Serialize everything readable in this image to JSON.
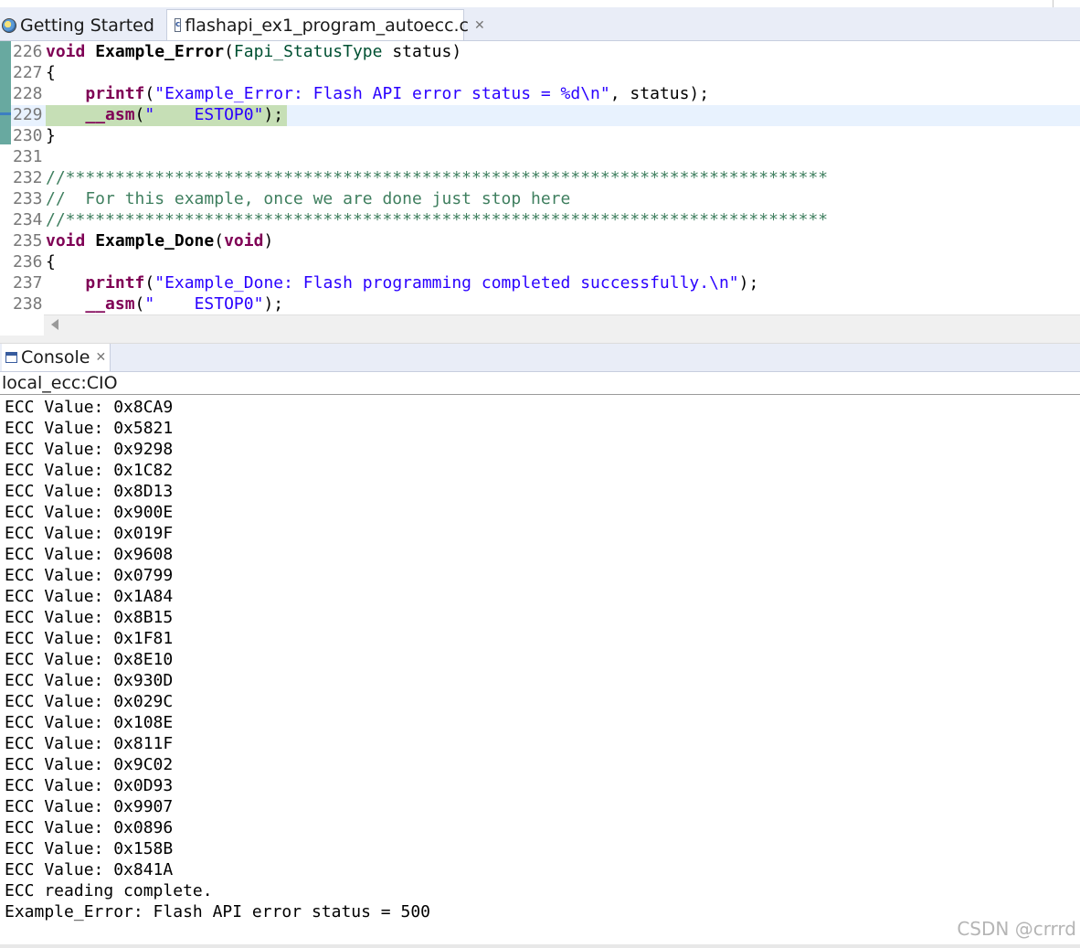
{
  "tabs": [
    {
      "label": "Getting Started",
      "icon": "ccs-globe-icon"
    },
    {
      "label": "flashapi_ex1_program_autoecc.c",
      "icon": "c-file-icon",
      "active": true
    }
  ],
  "editor": {
    "lines": [
      {
        "num": "226",
        "tokens": [
          {
            "t": "void ",
            "c": "kw"
          },
          {
            "t": "Example_Error",
            "c": "fn"
          },
          {
            "t": "(",
            "c": ""
          },
          {
            "t": "Fapi_StatusType",
            "c": "ty"
          },
          {
            "t": " status)",
            "c": ""
          }
        ]
      },
      {
        "num": "227",
        "tokens": [
          {
            "t": "{",
            "c": ""
          }
        ]
      },
      {
        "num": "228",
        "tokens": [
          {
            "t": "    ",
            "c": ""
          },
          {
            "t": "printf",
            "c": "kw"
          },
          {
            "t": "(",
            "c": ""
          },
          {
            "t": "\"Example_Error: Flash API error status = %d\\n\"",
            "c": "str"
          },
          {
            "t": ", status);",
            "c": ""
          }
        ]
      },
      {
        "num": "229",
        "tokens": [
          {
            "t": "    ",
            "c": ""
          },
          {
            "t": "__asm",
            "c": "kw"
          },
          {
            "t": "(",
            "c": ""
          },
          {
            "t": "\"    ESTOP0\"",
            "c": "str"
          },
          {
            "t": ");",
            "c": ""
          }
        ]
      },
      {
        "num": "230",
        "tokens": [
          {
            "t": "}",
            "c": ""
          }
        ]
      },
      {
        "num": "231",
        "tokens": []
      },
      {
        "num": "232",
        "tokens": [
          {
            "t": "//*****************************************************************************",
            "c": "cm"
          }
        ]
      },
      {
        "num": "233",
        "tokens": [
          {
            "t": "//  For this example, once we are done just stop here",
            "c": "cm"
          }
        ]
      },
      {
        "num": "234",
        "tokens": [
          {
            "t": "//*****************************************************************************",
            "c": "cm"
          }
        ]
      },
      {
        "num": "235",
        "tokens": [
          {
            "t": "void ",
            "c": "kw"
          },
          {
            "t": "Example_Done",
            "c": "fn"
          },
          {
            "t": "(",
            "c": ""
          },
          {
            "t": "void",
            "c": "kw"
          },
          {
            "t": ")",
            "c": ""
          }
        ]
      },
      {
        "num": "236",
        "tokens": [
          {
            "t": "{",
            "c": ""
          }
        ]
      },
      {
        "num": "237",
        "tokens": [
          {
            "t": "    ",
            "c": ""
          },
          {
            "t": "printf",
            "c": "kw"
          },
          {
            "t": "(",
            "c": ""
          },
          {
            "t": "\"Example_Done: Flash programming completed successfully.\\n\"",
            "c": "str"
          },
          {
            "t": ");",
            "c": ""
          }
        ]
      },
      {
        "num": "238",
        "tokens": [
          {
            "t": "    ",
            "c": ""
          },
          {
            "t": "__asm",
            "c": "kw"
          },
          {
            "t": "(",
            "c": ""
          },
          {
            "t": "\"    ESTOP0\"",
            "c": "str"
          },
          {
            "t": ");",
            "c": ""
          }
        ]
      }
    ]
  },
  "console": {
    "tab_label": "Console",
    "title": "local_ecc:CIO",
    "lines": [
      "ECC Value: 0x8CA9",
      "ECC Value: 0x5821",
      "ECC Value: 0x9298",
      "ECC Value: 0x1C82",
      "ECC Value: 0x8D13",
      "ECC Value: 0x900E",
      "ECC Value: 0x019F",
      "ECC Value: 0x9608",
      "ECC Value: 0x0799",
      "ECC Value: 0x1A84",
      "ECC Value: 0x8B15",
      "ECC Value: 0x1F81",
      "ECC Value: 0x8E10",
      "ECC Value: 0x930D",
      "ECC Value: 0x029C",
      "ECC Value: 0x108E",
      "ECC Value: 0x811F",
      "ECC Value: 0x9C02",
      "ECC Value: 0x0D93",
      "ECC Value: 0x9907",
      "ECC Value: 0x0896",
      "ECC Value: 0x158B",
      "ECC Value: 0x841A",
      "ECC reading complete.",
      "Example_Error: Flash API error status = 500"
    ]
  },
  "watermark": "CSDN @crrrd",
  "colors": {
    "keyword": "#7f0055",
    "string": "#2a00ff",
    "comment": "#3f7f5f",
    "type": "#005032",
    "current_line": "#e8f2fe",
    "selection": "#c6dfb6",
    "tabbar": "#e9edf7"
  }
}
